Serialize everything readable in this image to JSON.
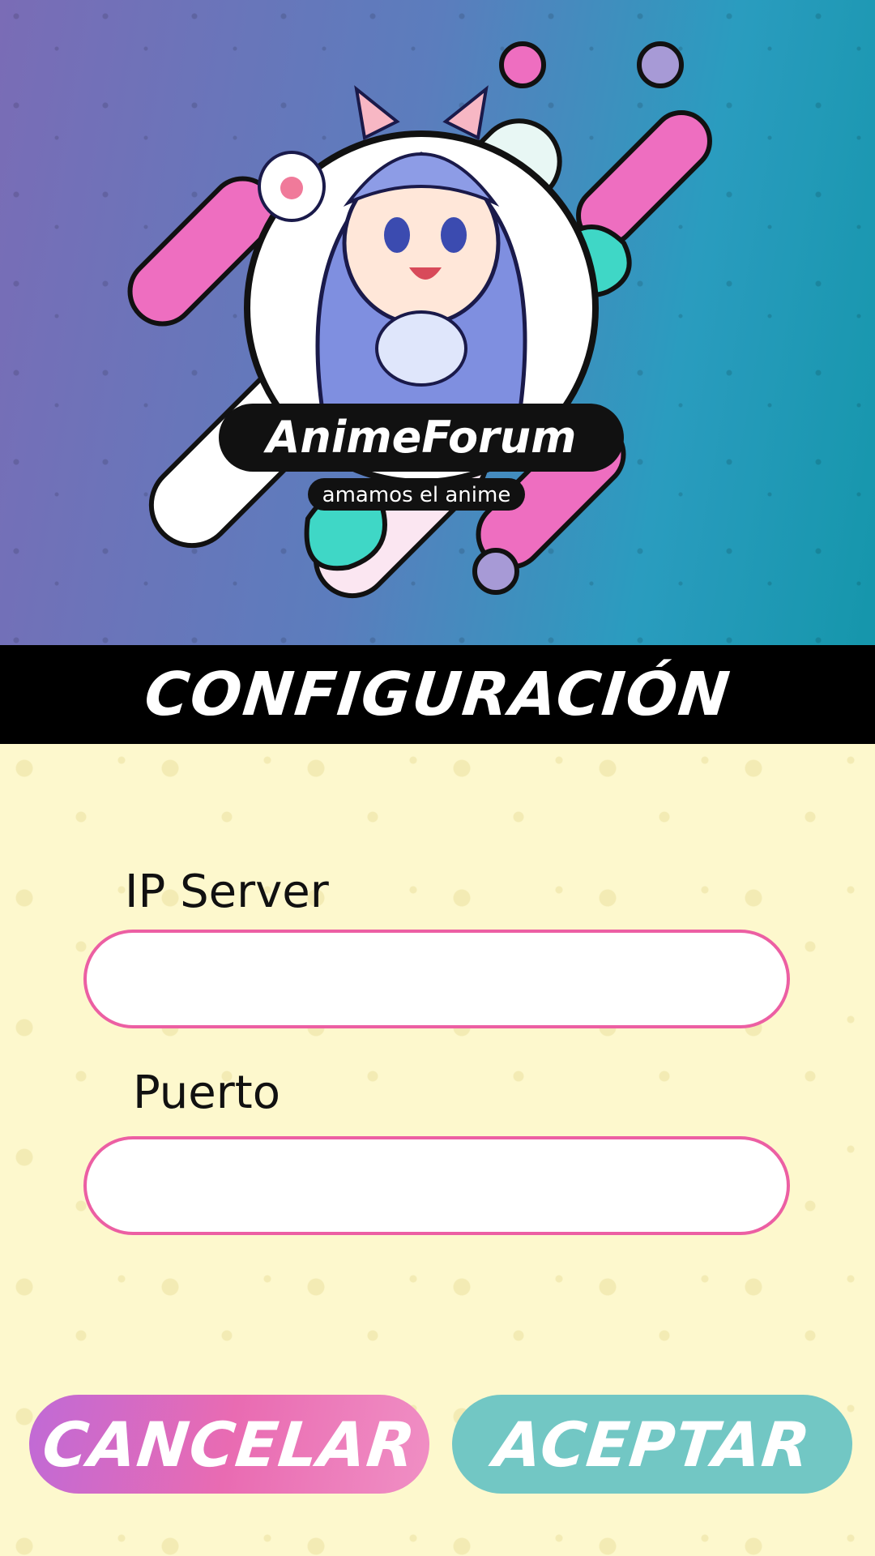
{
  "header": {
    "logo_title": "AnimeForum",
    "logo_subtitle": "amamos el anime"
  },
  "title": "Configuración",
  "form": {
    "ip_label": "IP Server",
    "ip_value": "",
    "port_label": "Puerto",
    "port_value": ""
  },
  "buttons": {
    "cancel_label": "Cancelar",
    "accept_label": "Aceptar"
  },
  "colors": {
    "input_border": "#ec5fa3",
    "cancel_button": "#e96bb2",
    "accept_button": "#72c7c4",
    "form_background": "#fdf8cd"
  }
}
